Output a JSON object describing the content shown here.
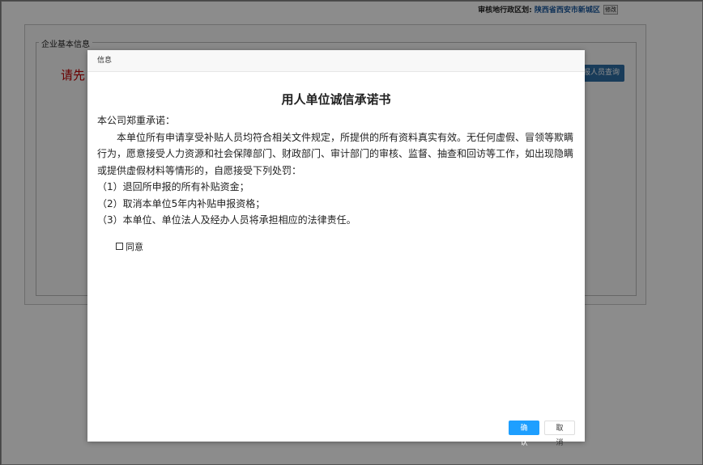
{
  "background": {
    "topbar": {
      "label": "审核地行政区划:",
      "region": "陕西省西安市新城区",
      "edit_label": "修改"
    },
    "section_legend": "企业基本信息",
    "partial_red_text": "请先",
    "partial_button": "报人员查询"
  },
  "dialog": {
    "header": "信息",
    "title": "用人单位诚信承诺书",
    "intro": "本公司郑重承诺：",
    "paragraph": "本单位所有申请享受补贴人员均符合相关文件规定，所提供的所有资料真实有效。无任何虚假、冒领等欺瞒行为，愿意接受人力资源和社会保障部门、财政部门、审计部门的审核、监督、抽查和回访等工作，如出现隐瞒或提供虚假材料等情形的，自愿接受下列处罚：",
    "items": [
      "（1）退回所申报的所有补贴资金；",
      "（2）取消本单位5年内补贴申报资格；",
      "（3）本单位、单位法人及经办人员将承担相应的法律责任。"
    ],
    "agree_label": "同意",
    "confirm_label": "确认",
    "cancel_label": "取消"
  },
  "colors": {
    "primary_button": "#1e9fff",
    "red_text": "#c00000",
    "secondary_blue": "#2e6da4"
  }
}
